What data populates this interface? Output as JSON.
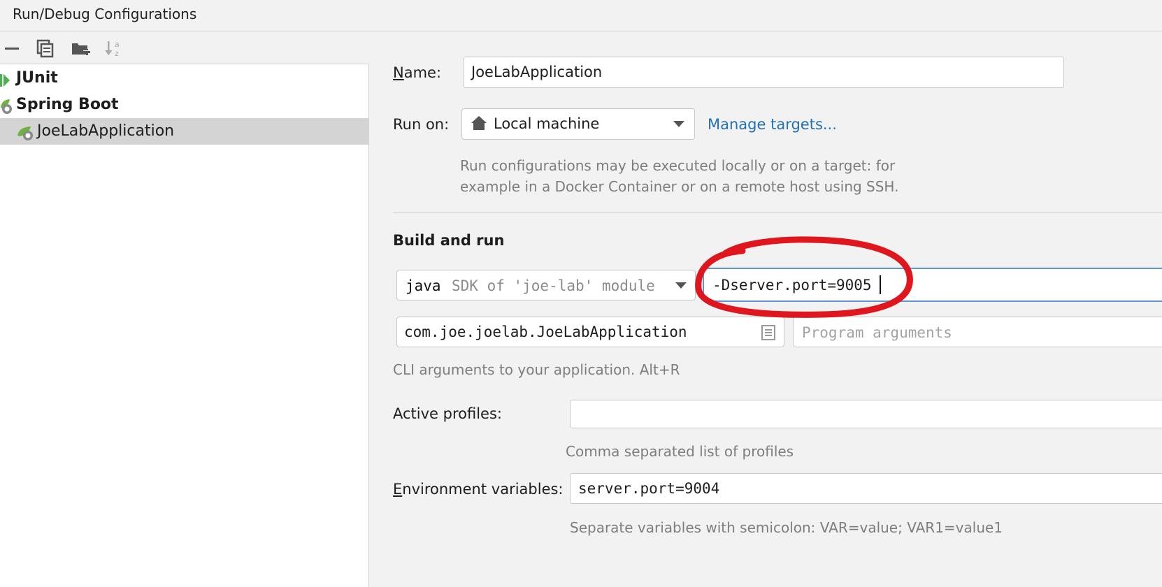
{
  "window": {
    "title": "Run/Debug Configurations"
  },
  "toolbar": {
    "icons": [
      "remove-icon",
      "copy-icon",
      "new-folder-icon",
      "sort-alphabetically-icon"
    ]
  },
  "tree": {
    "items": [
      {
        "label": "JUnit",
        "icon": "junit-icon"
      },
      {
        "label": "Spring Boot",
        "icon": "spring-boot-icon"
      },
      {
        "label": "JoeLabApplication",
        "icon": "spring-boot-app-icon",
        "selected": true
      }
    ]
  },
  "form": {
    "name_label_accel": "N",
    "name_label_rest": "ame:",
    "name_value": "JoeLabApplication",
    "run_on_label": "Run on:",
    "run_on_value": "Local machine",
    "manage_targets": "Manage targets...",
    "run_on_hint_line1": "Run configurations may be executed locally or on a target: for",
    "run_on_hint_line2": "example in a Docker Container or on a remote host using SSH.",
    "build_and_run": "Build and run",
    "jdk_name": "java",
    "jdk_desc": "SDK of 'joe-lab' module",
    "vm_options_value": "-Dserver.port=9005",
    "main_class_value": "com.joe.joelab.JoeLabApplication",
    "program_args_placeholder": "Program arguments",
    "cli_hint": "CLI arguments to your application. Alt+R",
    "active_profiles_label": "Active profiles:",
    "active_profiles_value": "",
    "active_profiles_hint": "Comma separated list of profiles",
    "env_label_accel": "E",
    "env_label_rest": "nvironment variables:",
    "env_value": "server.port=9004",
    "env_hint": "Separate variables with semicolon: VAR=value; VAR1=value1"
  },
  "colors": {
    "annotation_red": "#e0161e",
    "link": "#2470b3",
    "focus_blue": "#5f95d6",
    "spring_green": "#6db33f"
  }
}
